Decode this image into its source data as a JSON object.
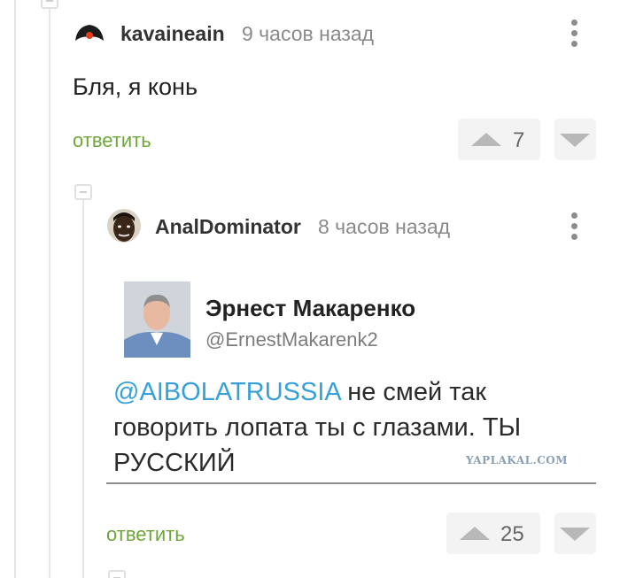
{
  "comment1": {
    "username": "kavaineain",
    "time": "9 часов назад",
    "text": "Бля, я конь",
    "reply_label": "ответить",
    "score": "7"
  },
  "comment2": {
    "username": "AnalDominator",
    "time": "8 часов назад",
    "reply_label": "ответить",
    "score": "25",
    "image": {
      "author_name": "Эрнест Макаренко",
      "author_handle": "@ErnestMakarenk2",
      "mention": "@AIBOLATRUSSIA",
      "text": " не смей так говорить лопата ты с глазами.  ТЫ РУССКИЙ",
      "watermark": "YAPLAKAL.COM"
    }
  },
  "colors": {
    "reply_green": "#6fa63a",
    "mention_blue": "#37a0d8",
    "thread_line": "#e6e6e6"
  }
}
